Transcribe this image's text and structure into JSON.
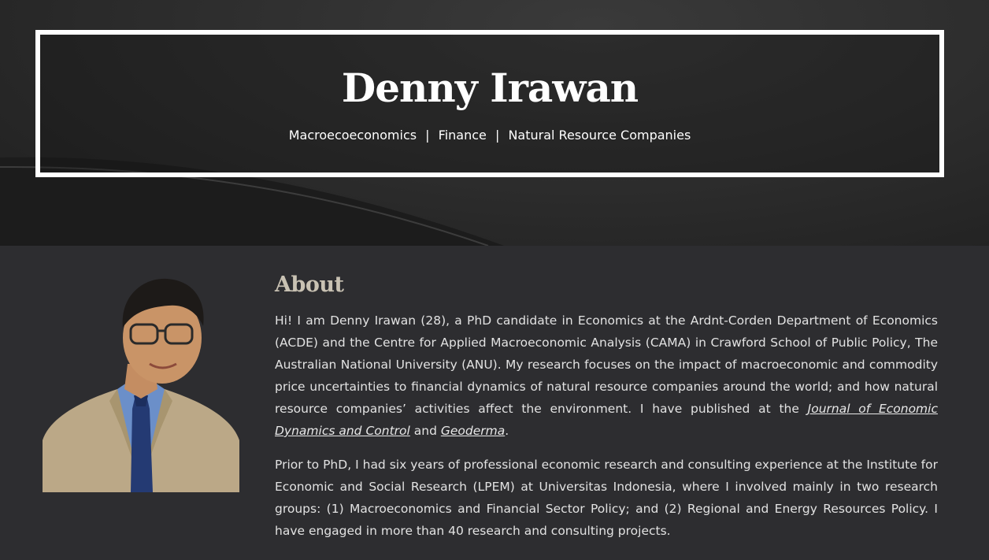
{
  "header": {
    "title": "Denny Irawan",
    "tagline": {
      "part1": "Macroecoeconomics",
      "separator": "|",
      "part2": "Finance",
      "part3": "Natural Resource Companies"
    }
  },
  "about": {
    "heading": "About",
    "paragraph1": {
      "text_before": "Hi! I am Denny Irawan (28), a PhD candidate in Economics at the Ardnt-Corden Department of Economics (ACDE) and the Centre for Applied Macroeconomic Analysis (CAMA) in Crawford School of Public Policy, The Australian National University (ANU). My research focuses on the impact of macroeconomic and commodity price uncertainties to financial dynamics of natural resource companies around the world; and how natural resource companies’ activities affect the environment. I have published at the ",
      "link1": "Journal of Economic Dynamics and Control",
      "text_middle": " and ",
      "link2": "Geoderma",
      "text_after": "."
    },
    "paragraph2": "Prior to PhD, I had six years of professional economic research and consulting experience at the Institute for Economic and Social Research (LPEM) at Universitas Indonesia, where I involved mainly in two research groups: (1) Macroeconomics and Financial Sector Policy; and (2) Regional and Energy Resources Policy. I have engaged in more than 40 research and consulting projects."
  },
  "photo": {
    "icon": "profile-photo"
  },
  "colors": {
    "background": "#2d2d30",
    "hero": "#2a2a2a",
    "title_border": "#ffffff",
    "heading": "#c9c2b3"
  }
}
